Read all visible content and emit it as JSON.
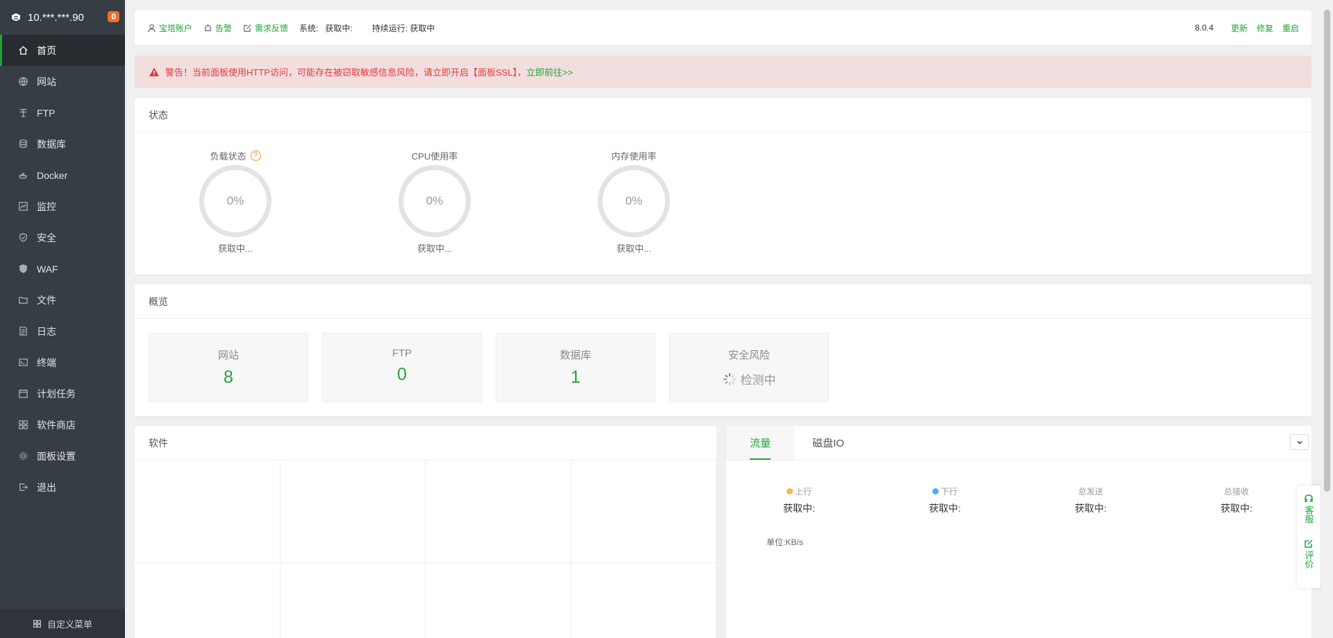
{
  "sidebar": {
    "server": "10.***.***.90",
    "badge": "0",
    "items": [
      {
        "label": "首页",
        "icon": "home-icon"
      },
      {
        "label": "网站",
        "icon": "globe-icon"
      },
      {
        "label": "FTP",
        "icon": "ftp-icon"
      },
      {
        "label": "数据库",
        "icon": "database-icon"
      },
      {
        "label": "Docker",
        "icon": "docker-icon"
      },
      {
        "label": "监控",
        "icon": "monitor-icon"
      },
      {
        "label": "安全",
        "icon": "shield-icon"
      },
      {
        "label": "WAF",
        "icon": "waf-icon"
      },
      {
        "label": "文件",
        "icon": "folder-icon"
      },
      {
        "label": "日志",
        "icon": "log-icon"
      },
      {
        "label": "终端",
        "icon": "terminal-icon"
      },
      {
        "label": "计划任务",
        "icon": "calendar-icon"
      },
      {
        "label": "软件商店",
        "icon": "grid-icon"
      },
      {
        "label": "面板设置",
        "icon": "gear-icon"
      },
      {
        "label": "退出",
        "icon": "logout-icon"
      }
    ],
    "custom_menu": "自定义菜单"
  },
  "topbar": {
    "account": "宝塔账户",
    "alarm": "告警",
    "feedback": "需求反馈",
    "system": "系统:   获取中:",
    "uptime": "持续运行: 获取中",
    "version": "8.0.4",
    "update": "更新",
    "repair": "修复",
    "restart": "重启"
  },
  "warning": {
    "text": "警告！当前面板使用HTTP访问，可能存在被窃取敏感信息风险，请立即开启【面板SSL】，",
    "link": "立即前往>>"
  },
  "status": {
    "title": "状态",
    "gauges": [
      {
        "title": "负载状态",
        "value": "0%",
        "sub": "获取中..."
      },
      {
        "title": "CPU使用率",
        "value": "0%",
        "sub": "获取中..."
      },
      {
        "title": "内存使用率",
        "value": "0%",
        "sub": "获取中..."
      }
    ],
    "help": "?"
  },
  "overview": {
    "title": "概览",
    "items": [
      {
        "label": "网站",
        "value": "8"
      },
      {
        "label": "FTP",
        "value": "0"
      },
      {
        "label": "数据库",
        "value": "1"
      },
      {
        "label": "安全风险",
        "value": "检测中"
      }
    ]
  },
  "software": {
    "title": "软件"
  },
  "traffic": {
    "tabs": [
      "流量",
      "磁盘IO"
    ],
    "stats": [
      {
        "label": "上行",
        "value": "获取中:",
        "color": "#f7b851"
      },
      {
        "label": "下行",
        "value": "获取中:",
        "color": "#52a9ff"
      },
      {
        "label": "总发送",
        "value": "获取中:"
      },
      {
        "label": "总接收",
        "value": "获取中:"
      }
    ],
    "unit": "单位:KB/s"
  },
  "float": {
    "service": "客服",
    "review": "评价"
  },
  "colors": {
    "accent": "#20a53a",
    "sidebar": "#363d44",
    "warning": "#e4393c"
  }
}
